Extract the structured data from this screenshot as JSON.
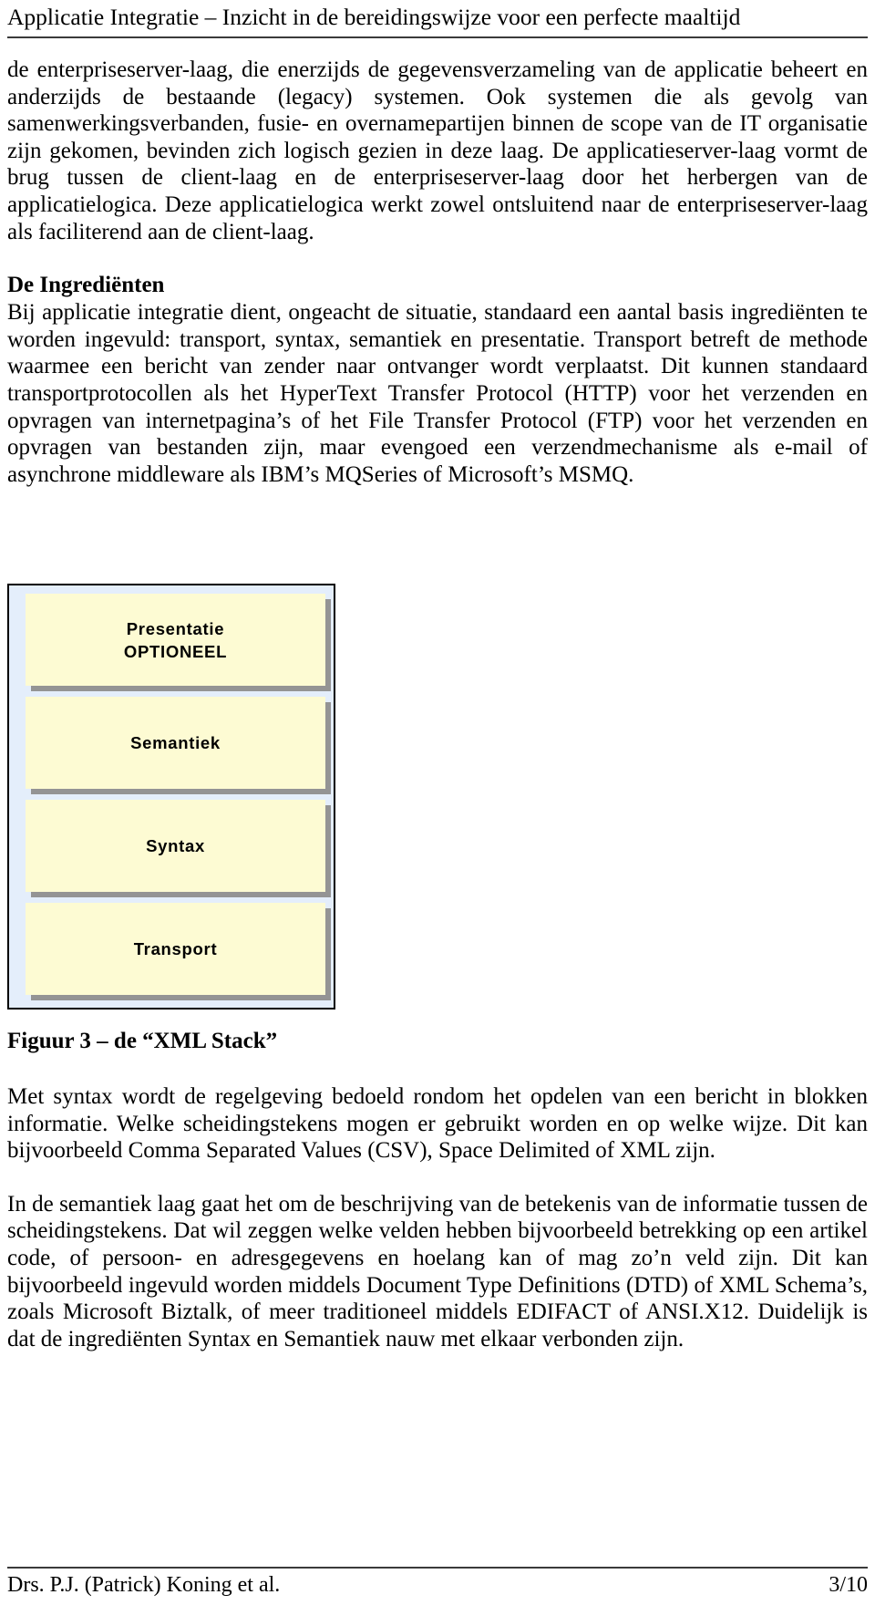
{
  "header": {
    "title": "Applicatie Integratie – Inzicht in de bereidingswijze voor een perfecte maaltijd"
  },
  "body": {
    "para1": "de enterpriseserver-laag, die enerzijds de gegevensverzameling van de applicatie beheert en anderzijds de bestaande (legacy) systemen. Ook systemen die als gevolg van samenwerkingsverbanden, fusie- en overnamepartijen binnen de scope van de IT organisatie zijn gekomen, bevinden zich logisch gezien in deze laag. De applicatieserver-laag vormt de brug tussen de client-laag en de enterpriseserver-laag door het herbergen van de applicatielogica. Deze applicatielogica werkt zowel ontsluitend naar de enterpriseserver-laag als faciliterend aan de client-laag.",
    "heading1": "De Ingrediënten",
    "para2": "Bij applicatie integratie dient, ongeacht de situatie, standaard een aantal basis ingrediënten te worden ingevuld: transport, syntax, semantiek en presentatie. Transport betreft de methode waarmee een bericht van zender naar ontvanger wordt verplaatst. Dit kunnen standaard transportprotocollen als het HyperText Transfer Protocol (HTTP) voor het verzenden en opvragen van internetpagina’s of het File Transfer Protocol (FTP) voor het verzenden en opvragen van bestanden zijn, maar evengoed een verzendmechanisme als e-mail of asynchrone middleware als IBM’s MQSeries of Microsoft’s MSMQ.",
    "para3": "Met syntax wordt de regelgeving bedoeld rondom het opdelen van een bericht in blokken informatie. Welke  scheidingstekens mogen er gebruikt worden en op welke wijze. Dit kan bijvoorbeeld Comma Separated Values (CSV), Space Delimited of XML zijn.",
    "para4": "In de semantiek laag gaat het om de beschrijving van de betekenis van de informatie tussen de scheidingstekens. Dat wil zeggen welke velden hebben bijvoorbeeld betrekking op een artikel code, of persoon- en adresgegevens en hoelang kan of mag zo’n veld zijn. Dit kan bijvoorbeeld ingevuld worden middels Document Type Definitions (DTD) of XML Schema’s, zoals Microsoft Biztalk, of meer traditioneel middels EDIFACT of ANSI.X12. Duidelijk is dat de ingrediënten Syntax en Semantiek nauw met elkaar verbonden zijn."
  },
  "figure": {
    "caption": "Figuur 3 – de “XML Stack”",
    "outer_fill": "#e4eefb",
    "box_fill": "#fdfbd3",
    "shadow_color": "#949494",
    "border_color": "#000000",
    "layers": [
      {
        "line1": "Presentatie",
        "line2": "OPTIONEEL"
      },
      {
        "line1": "Semantiek",
        "line2": ""
      },
      {
        "line1": "Syntax",
        "line2": ""
      },
      {
        "line1": "Transport",
        "line2": ""
      }
    ]
  },
  "footer": {
    "author": "Drs. P.J. (Patrick) Koning et al.",
    "page": "3/10"
  }
}
